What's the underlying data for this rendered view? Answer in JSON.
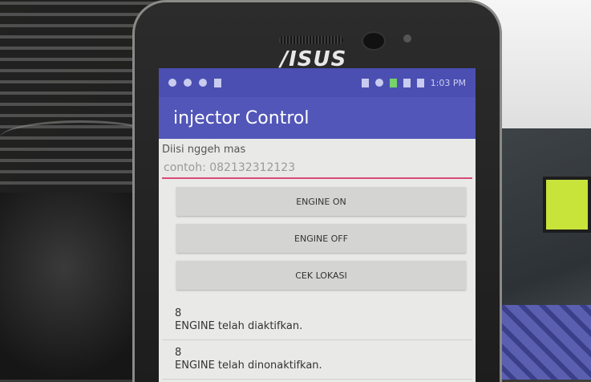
{
  "phone": {
    "brand": "/ISUS",
    "status_bar": {
      "time": "1:03 PM"
    },
    "app": {
      "title": "injector Control",
      "input_label": "Diisi nggeh mas",
      "input_placeholder": "contoh: 082132312123",
      "buttons": [
        {
          "label": "ENGINE ON"
        },
        {
          "label": "ENGINE OFF"
        },
        {
          "label": "CEK LOKASI"
        }
      ],
      "messages": [
        {
          "number": "8",
          "text": "ENGINE telah diaktifkan."
        },
        {
          "number": "8",
          "text": "ENGINE telah dinonaktifkan."
        }
      ]
    }
  },
  "colors": {
    "status_bar": "#4b4fb2",
    "app_bar": "#5256b8",
    "input_underline": "#d84a7a",
    "lcd": "#c8e33a"
  }
}
